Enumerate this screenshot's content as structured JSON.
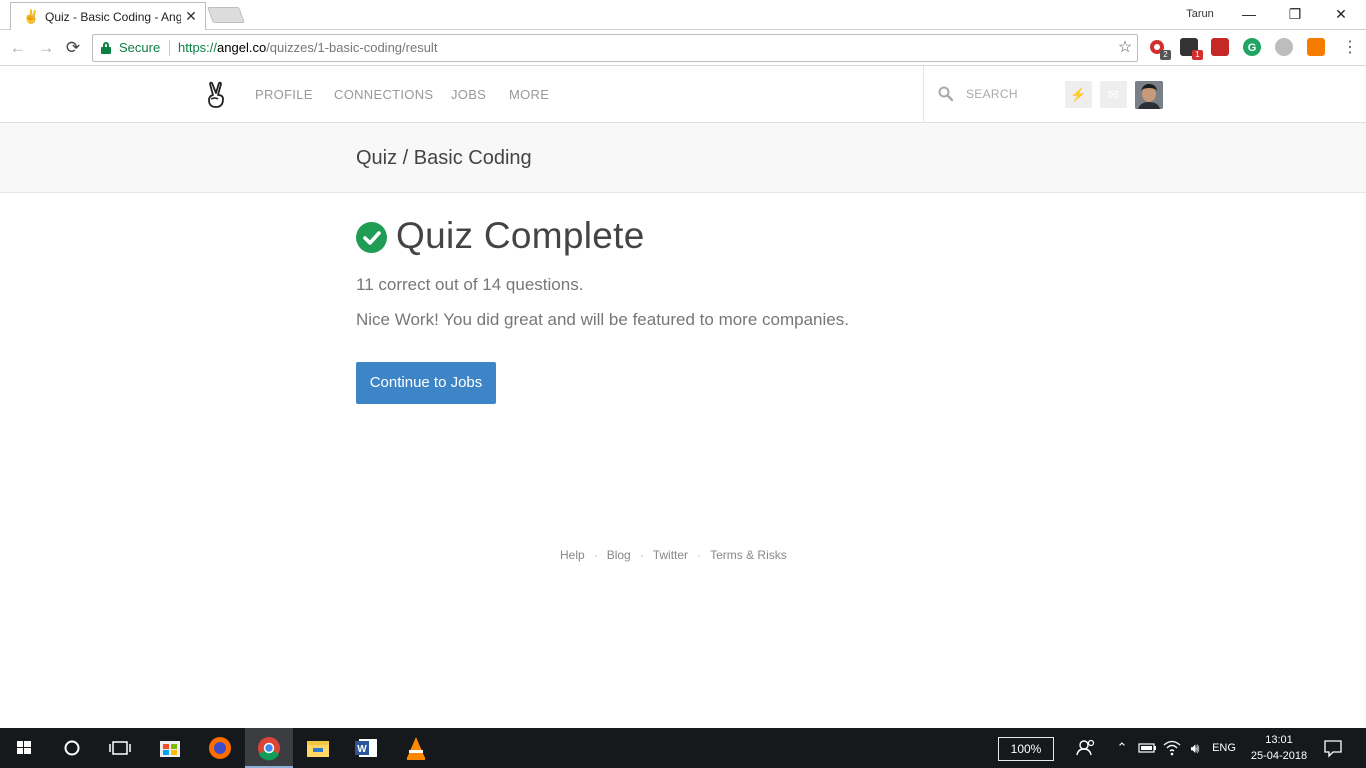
{
  "browser": {
    "tab": {
      "title": "Quiz - Basic Coding - Angel",
      "favicon": "angellist-peace-icon",
      "close": "✕"
    },
    "profile_name": "Tarun",
    "window_controls": {
      "minimize": "—",
      "maximize": "❐",
      "close": "✕"
    },
    "nav": {
      "back": "←",
      "forward": "→",
      "reload": "⟳"
    },
    "omnibox": {
      "security_label": "Secure",
      "url_scheme": "https://",
      "url_host": "angel.co",
      "url_path": "/quizzes/1-basic-coding/result"
    },
    "star": "☆",
    "menu": "⋮",
    "extension_badges": {
      "ext1": "2",
      "ext2": "1"
    }
  },
  "site": {
    "nav_items": [
      "PROFILE",
      "CONNECTIONS",
      "JOBS",
      "MORE"
    ],
    "search_placeholder": "SEARCH",
    "header_icons": {
      "activity": "⚡",
      "messages": "✉"
    }
  },
  "page": {
    "breadcrumb": "Quiz / Basic Coding",
    "title": "Quiz Complete",
    "result": "11 correct out of 14 questions.",
    "message": "Nice Work! You did great and will be featured to more companies.",
    "continue_label": "Continue to Jobs"
  },
  "footer": {
    "links": [
      "Help",
      "Blog",
      "Twitter",
      "Terms & Risks"
    ],
    "separator": "·"
  },
  "taskbar": {
    "zoom": "100%",
    "language": "ENG",
    "time": "13:01",
    "date": "25-04-2018"
  },
  "colors": {
    "accent_button": "#3d85c6",
    "success_check": "#1f9d55",
    "secure_green": "#0b8043"
  }
}
